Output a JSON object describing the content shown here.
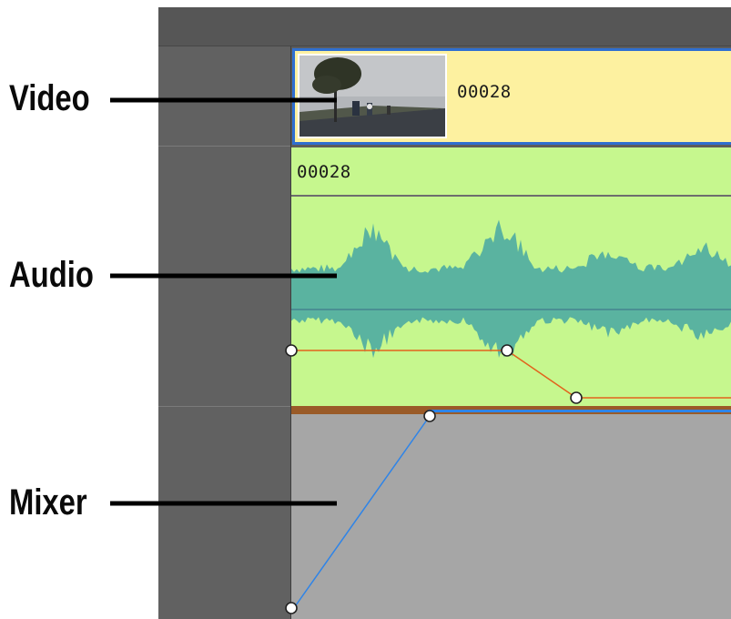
{
  "callouts": {
    "video": "Video",
    "audio": "Audio",
    "mixer": "Mixer"
  },
  "tracks": {
    "video_clip": {
      "name": "00028"
    },
    "audio_clip": {
      "name": "00028"
    }
  },
  "colors": {
    "video_clip_fill": "#fdf1a0",
    "video_clip_selected_border": "#2f6fd0",
    "audio_clip_fill": "#c6f78e",
    "waveform": "#5ab3a0",
    "volume_envelope": "#e2631c",
    "mixer_envelope": "#2e84e8",
    "mixer_fill": "#a6a6a6"
  }
}
